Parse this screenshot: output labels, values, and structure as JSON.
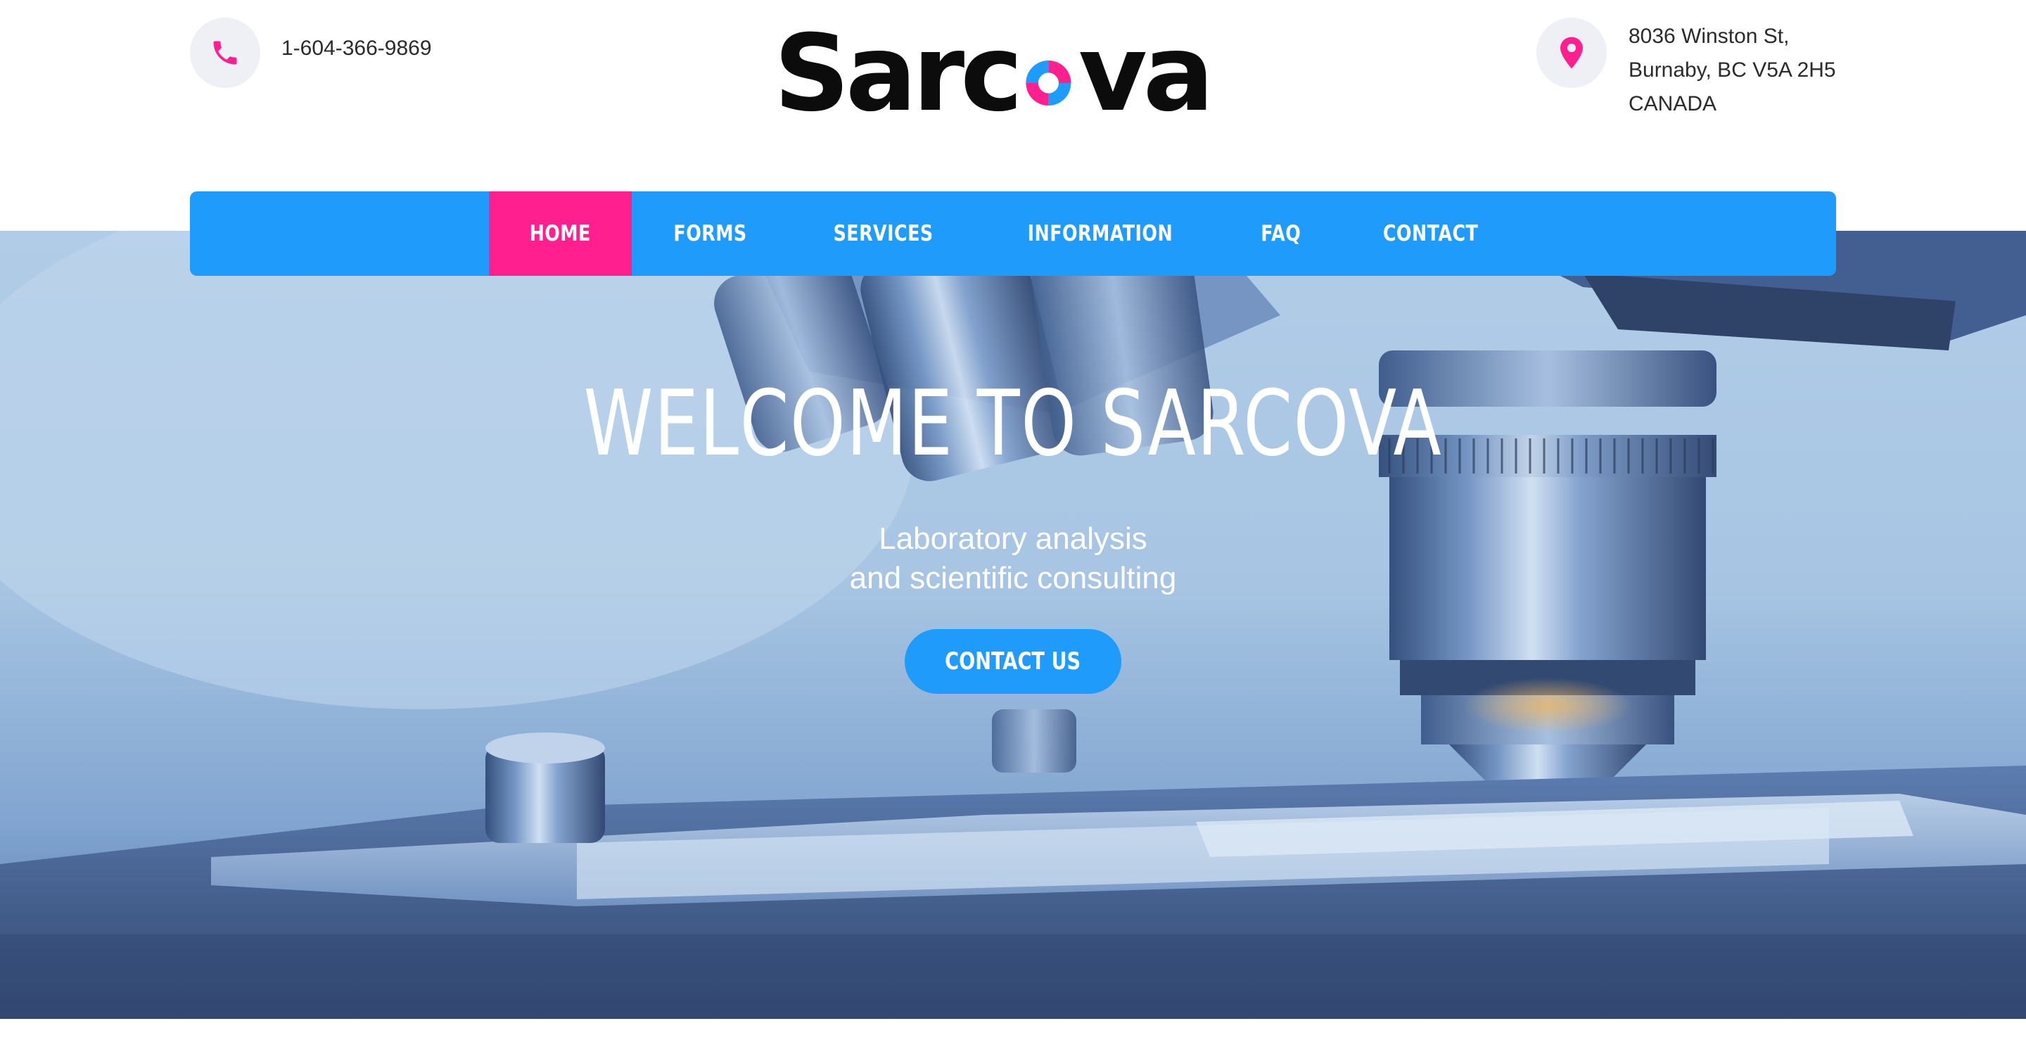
{
  "header": {
    "phone": "1-604-366-9869",
    "address": [
      "8036 Winston St,",
      "Burnaby, BC V5A 2H5",
      "CANADA"
    ],
    "logo_text": "Sarcova",
    "logo_parts": {
      "left": "Sarc",
      "right": "va"
    }
  },
  "nav": {
    "items": [
      {
        "label": "HOME",
        "active": true
      },
      {
        "label": "FORMS",
        "active": false
      },
      {
        "label": "SERVICES",
        "active": false
      },
      {
        "label": "INFORMATION",
        "active": false
      },
      {
        "label": "FAQ",
        "active": false
      },
      {
        "label": "CONTACT",
        "active": false
      }
    ]
  },
  "hero": {
    "title": "WELCOME TO SARCOVA",
    "subtitle_line1": "Laboratory analysis",
    "subtitle_line2": "and scientific consulting",
    "cta_label": "CONTACT US",
    "background": "microscope-photo"
  },
  "icons": {
    "phone": "phone-icon",
    "location": "location-pin-icon"
  },
  "colors": {
    "accent_blue": "#1e9bfb",
    "accent_pink": "#ff1f8e",
    "text_dark": "#2b2b2b",
    "icon_bg": "#eef0f6",
    "white": "#ffffff"
  }
}
